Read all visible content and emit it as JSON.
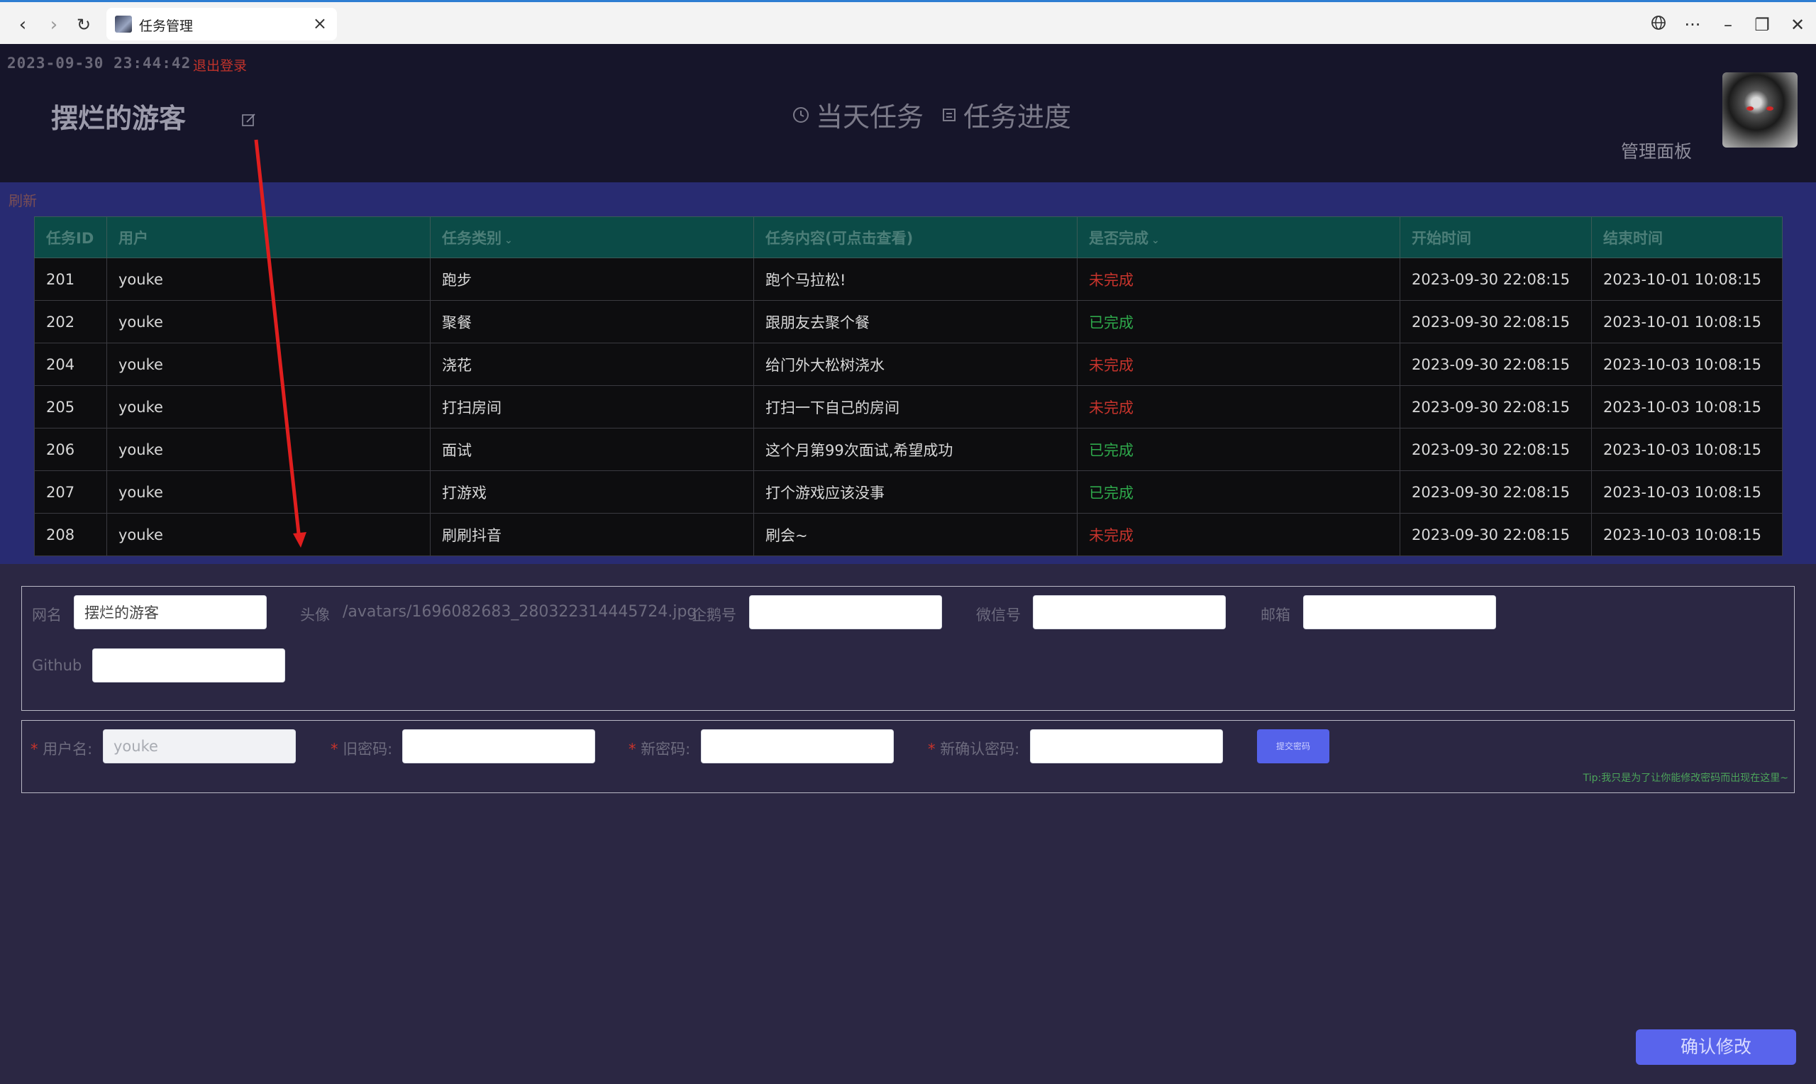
{
  "browser": {
    "tab_title": "任务管理",
    "tab_close": "×",
    "back": "‹",
    "forward": "›",
    "reload": "↻",
    "more": "···",
    "minimize": "–",
    "restore": "❐",
    "close": "✕"
  },
  "header": {
    "datetime": "2023-09-30 23:44:42",
    "logout": "退出登录",
    "username": "摆烂的游客",
    "nav": [
      {
        "label": "当天任务",
        "icon": "clock-icon"
      },
      {
        "label": "任务进度",
        "icon": "document-icon"
      }
    ],
    "admin_panel": "管理面板"
  },
  "table": {
    "refresh": "刷新",
    "columns": [
      "任务ID",
      "用户",
      "任务类别",
      "任务内容(可点击查看)",
      "是否完成",
      "开始时间",
      "结束时间"
    ],
    "filter_chevron": "⌄",
    "rows": [
      {
        "id": "201",
        "user": "youke",
        "category": "跑步",
        "content": "跑个马拉松!",
        "status": "未完成",
        "done": false,
        "start": "2023-09-30 22:08:15",
        "end": "2023-10-01 10:08:15"
      },
      {
        "id": "202",
        "user": "youke",
        "category": "聚餐",
        "content": "跟朋友去聚个餐",
        "status": "已完成",
        "done": true,
        "start": "2023-09-30 22:08:15",
        "end": "2023-10-01 10:08:15"
      },
      {
        "id": "204",
        "user": "youke",
        "category": "浇花",
        "content": "给门外大松树浇水",
        "status": "未完成",
        "done": false,
        "start": "2023-09-30 22:08:15",
        "end": "2023-10-03 10:08:15"
      },
      {
        "id": "205",
        "user": "youke",
        "category": "打扫房间",
        "content": "打扫一下自己的房间",
        "status": "未完成",
        "done": false,
        "start": "2023-09-30 22:08:15",
        "end": "2023-10-03 10:08:15"
      },
      {
        "id": "206",
        "user": "youke",
        "category": "面试",
        "content": "这个月第99次面试,希望成功",
        "status": "已完成",
        "done": true,
        "start": "2023-09-30 22:08:15",
        "end": "2023-10-03 10:08:15"
      },
      {
        "id": "207",
        "user": "youke",
        "category": "打游戏",
        "content": "打个游戏应该没事",
        "status": "已完成",
        "done": true,
        "start": "2023-09-30 22:08:15",
        "end": "2023-10-03 10:08:15"
      },
      {
        "id": "208",
        "user": "youke",
        "category": "刷刷抖音",
        "content": "刷会~",
        "status": "未完成",
        "done": false,
        "start": "2023-09-30 22:08:15",
        "end": "2023-10-03 10:08:15"
      }
    ]
  },
  "profile": {
    "nickname_label": "网名",
    "nickname_value": "摆烂的游客",
    "avatar_label": "头像",
    "avatar_path": "/avatars/1696082683_280322314445724.jpg",
    "qq_label": "企鹅号",
    "qq_value": "",
    "wechat_label": "微信号",
    "wechat_value": "",
    "email_label": "邮箱",
    "email_value": "",
    "github_label": "Github",
    "github_value": ""
  },
  "password": {
    "required_mark": "*",
    "username_label": "用户名:",
    "username_value": "youke",
    "old_label": "旧密码:",
    "new_label": "新密码:",
    "confirm_label": "新确认密码:",
    "submit": "提交密码",
    "tip": "Tip:我只是为了让你能修改密码而出现在这里~"
  },
  "confirm_button": "确认修改",
  "colors": {
    "header_bg": "#16152a",
    "table_section_bg": "#282b72",
    "table_header_bg": "#0b4b47",
    "status_done": "#2ea84b",
    "status_undone": "#c7342c",
    "accent": "#5964ec",
    "annotation_arrow": "#e01e1e"
  }
}
